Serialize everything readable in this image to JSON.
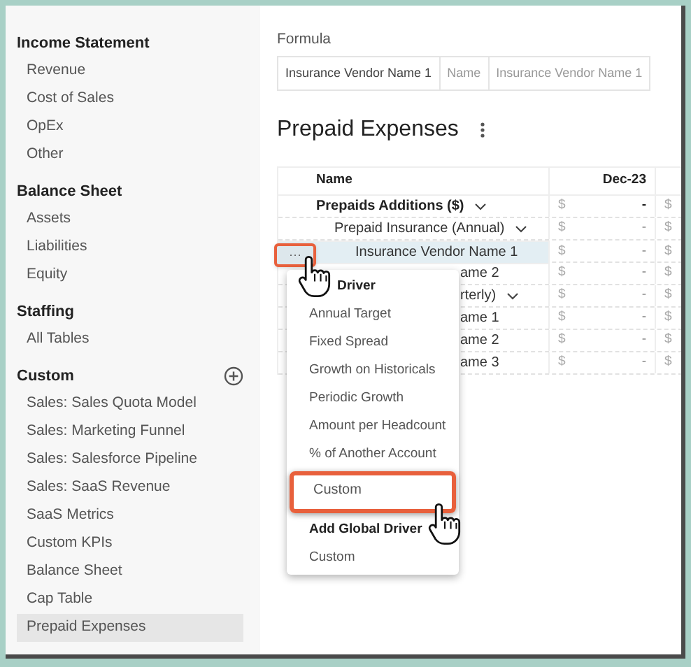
{
  "sidebar": {
    "sections": [
      {
        "title": "Income Statement",
        "addable": false,
        "items": [
          {
            "label": "Revenue",
            "selected": false
          },
          {
            "label": "Cost of Sales",
            "selected": false
          },
          {
            "label": "OpEx",
            "selected": false
          },
          {
            "label": "Other",
            "selected": false
          }
        ]
      },
      {
        "title": "Balance Sheet",
        "addable": false,
        "items": [
          {
            "label": "Assets",
            "selected": false
          },
          {
            "label": "Liabilities",
            "selected": false
          },
          {
            "label": "Equity",
            "selected": false
          }
        ]
      },
      {
        "title": "Staffing",
        "addable": false,
        "items": [
          {
            "label": "All Tables",
            "selected": false
          }
        ]
      },
      {
        "title": "Custom",
        "addable": true,
        "items": [
          {
            "label": "Sales: Sales Quota Model",
            "selected": false
          },
          {
            "label": "Sales: Marketing Funnel",
            "selected": false
          },
          {
            "label": "Sales: Salesforce Pipeline",
            "selected": false
          },
          {
            "label": "Sales: SaaS Revenue",
            "selected": false
          },
          {
            "label": "SaaS Metrics",
            "selected": false
          },
          {
            "label": "Custom KPIs",
            "selected": false
          },
          {
            "label": "Balance Sheet",
            "selected": false
          },
          {
            "label": "Cap Table",
            "selected": false
          },
          {
            "label": "Prepaid Expenses",
            "selected": true
          }
        ]
      }
    ]
  },
  "formula": {
    "label": "Formula",
    "cells": [
      "Insurance Vendor Name 1",
      "Name",
      "Insurance Vendor Name 1"
    ]
  },
  "title": "Prepaid Expenses",
  "table": {
    "columns": [
      "Name",
      "Dec-23"
    ],
    "rows": [
      {
        "name": "Prepaids Additions ($)",
        "bold": true,
        "partial": false,
        "selected": false,
        "expanded": true,
        "cells": [
          "$",
          "-",
          "$"
        ],
        "children": [
          {
            "name": "Prepaid Insurance (Annual)",
            "bold": false,
            "partial": false,
            "selected": false,
            "expanded": true,
            "cells": [
              "$",
              "-",
              "$"
            ],
            "children": [
              {
                "name": "Insurance Vendor Name 1",
                "bold": false,
                "partial": false,
                "selected": true,
                "cells": [
                  "$",
                  "-",
                  "$"
                ]
              },
              {
                "name": "ame 2",
                "bold": false,
                "partial": true,
                "selected": false,
                "cells": [
                  "$",
                  "-",
                  "$"
                ]
              }
            ]
          },
          {
            "name": "rterly)",
            "bold": false,
            "partial": true,
            "selected": false,
            "expanded": true,
            "cells": [
              "$",
              "-",
              "$"
            ],
            "children": [
              {
                "name": "ame 1",
                "bold": false,
                "partial": true,
                "selected": false,
                "cells": [
                  "$",
                  "-",
                  "$"
                ]
              },
              {
                "name": "ame 2",
                "bold": false,
                "partial": true,
                "selected": false,
                "cells": [
                  "$",
                  "-",
                  "$"
                ]
              },
              {
                "name": "ame 3",
                "bold": false,
                "partial": true,
                "selected": false,
                "cells": [
                  "$",
                  "-",
                  "$"
                ]
              }
            ]
          }
        ]
      }
    ]
  },
  "row_menu_button": "···",
  "menu": [
    {
      "kind": "header",
      "label": "Driver",
      "highlighted": false
    },
    {
      "kind": "option",
      "label": "Annual Target",
      "highlighted": false
    },
    {
      "kind": "option",
      "label": "Fixed Spread",
      "highlighted": false
    },
    {
      "kind": "option",
      "label": "Growth on Historicals",
      "highlighted": false
    },
    {
      "kind": "option",
      "label": "Periodic Growth",
      "highlighted": false
    },
    {
      "kind": "option",
      "label": "Amount per Headcount",
      "highlighted": false
    },
    {
      "kind": "option",
      "label": "% of Another Account",
      "highlighted": false
    },
    {
      "kind": "option",
      "label": "Custom",
      "highlighted": true
    },
    {
      "kind": "header",
      "label": "Add Global Driver",
      "highlighted": false
    },
    {
      "kind": "option",
      "label": "Custom",
      "highlighted": false
    }
  ]
}
